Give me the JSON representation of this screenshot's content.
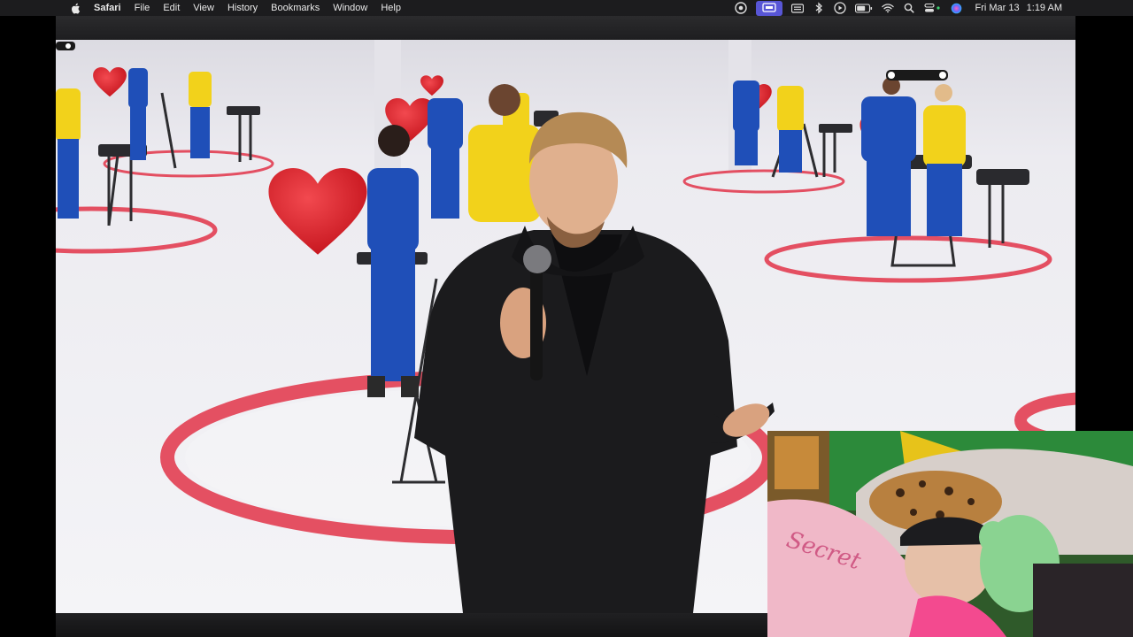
{
  "menubar": {
    "app_name": "Safari",
    "items": [
      "File",
      "Edit",
      "View",
      "History",
      "Bookmarks",
      "Window",
      "Help"
    ],
    "status_icons": [
      "creative-cloud-icon",
      "screen-mirror-icon",
      "keyboard-icon",
      "bluetooth-icon",
      "play-icon",
      "battery-icon",
      "wifi-icon",
      "search-icon",
      "control-center-icon",
      "siri-icon"
    ],
    "date": "Fri Mar 13",
    "time": "1:19 AM"
  },
  "webcam_overlay": {
    "blanket_text": "Secret"
  },
  "colors": {
    "menubar_bg": "#1c1c1e",
    "studio_floor": "#f1f1f4",
    "ring_red": "#e3475a",
    "heart_red": "#e0262f",
    "jersey_blue": "#1f4fb8",
    "jersey_yellow": "#f2d21b"
  }
}
